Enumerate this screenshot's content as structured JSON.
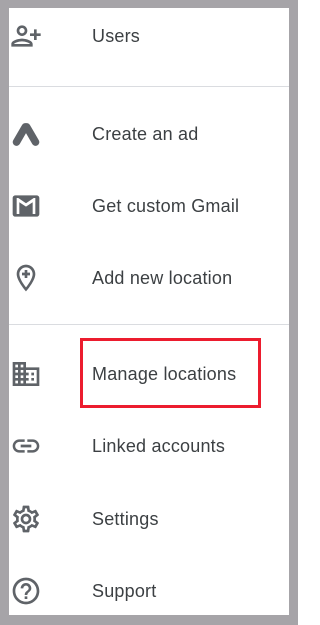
{
  "menu": {
    "items": [
      {
        "label": "Users",
        "icon": "add-user-icon"
      },
      {
        "label": "Create an ad",
        "icon": "google-ads-icon"
      },
      {
        "label": "Get custom Gmail",
        "icon": "gmail-icon"
      },
      {
        "label": "Add new location",
        "icon": "add-location-icon"
      },
      {
        "label": "Manage locations",
        "icon": "business-building-icon"
      },
      {
        "label": "Linked accounts",
        "icon": "link-icon"
      },
      {
        "label": "Settings",
        "icon": "gear-icon"
      },
      {
        "label": "Support",
        "icon": "help-circle-icon"
      }
    ]
  },
  "colors": {
    "frame": "#a6a4a8",
    "highlight": "#ec1c2e",
    "icon": "#5f6368",
    "text": "#3c4043"
  }
}
